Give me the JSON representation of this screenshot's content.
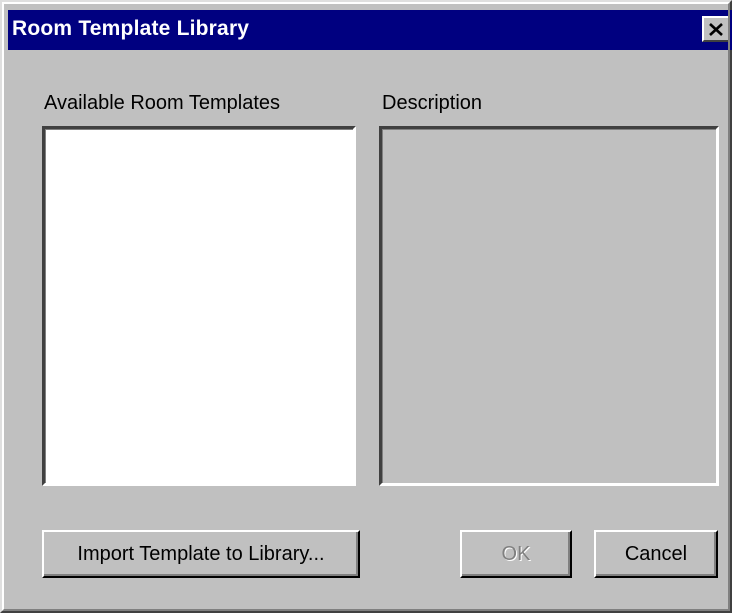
{
  "window": {
    "title": "Room Template Library",
    "close_icon": "close-x-icon"
  },
  "templates_list": {
    "label": "Available Room Templates",
    "items": []
  },
  "description": {
    "label": "Description",
    "text": ""
  },
  "buttons": {
    "import_label": "Import Template to Library...",
    "ok_label": "OK",
    "ok_enabled": false,
    "cancel_label": "Cancel"
  },
  "colors": {
    "title_bar": "#000080",
    "title_text": "#ffffff",
    "dialog_face": "#c0c0c0",
    "list_background": "#ffffff",
    "disabled_text": "#808080"
  }
}
